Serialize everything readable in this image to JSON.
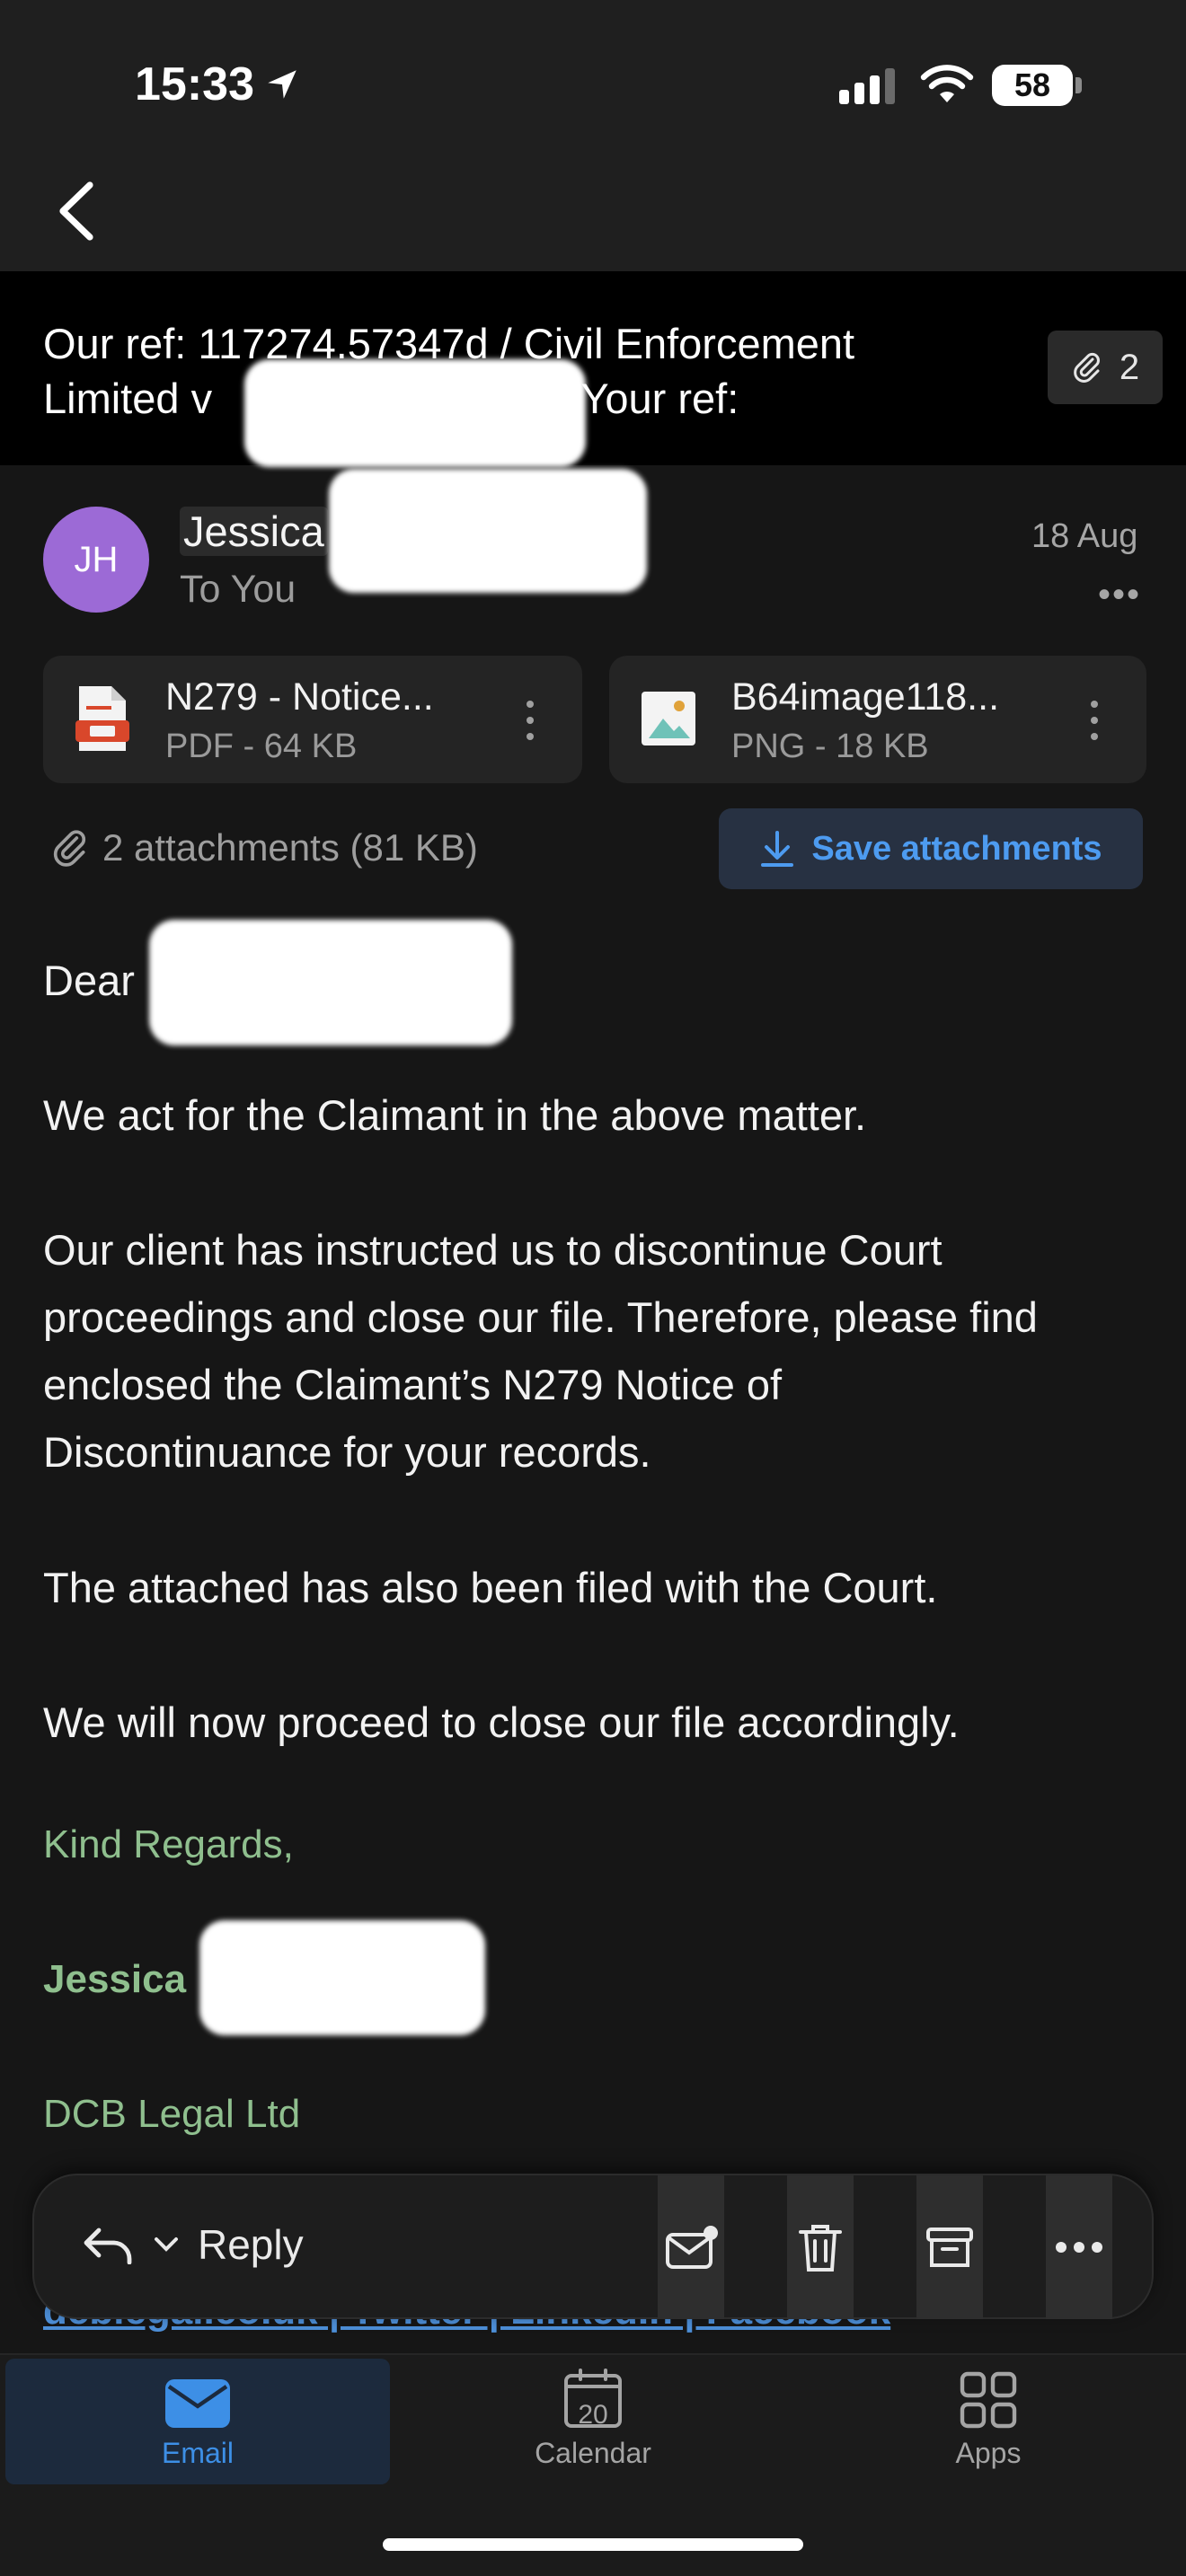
{
  "status_bar": {
    "time": "15:33",
    "battery": "58"
  },
  "subject": {
    "text": "Our ref: 117274.57347d / Civil Enforcement Limited v ████████████ / Your ref:",
    "line1": "Our ref: 117274.57347d / Civil Enforcement",
    "line2_a": "Limited v",
    "line2_b": "/ Your ref:",
    "attachment_count": "2"
  },
  "sender": {
    "initials": "JH",
    "name": "Jessica",
    "recipient": "To You",
    "date": "18 Aug",
    "more": "•••"
  },
  "attachments": [
    {
      "name": "N279 - Notice...",
      "meta": "PDF - 64 KB",
      "icon": "pdf-file-icon"
    },
    {
      "name": "B64image118...",
      "meta": "PNG - 18 KB",
      "icon": "image-file-icon"
    }
  ],
  "attachment_summary": "2 attachments (81 KB)",
  "save_button": "Save attachments",
  "body": {
    "greeting": "Dear",
    "p1": "We act for the Claimant in the above matter.",
    "p2_l1": "Our client has instructed us to discontinue Court",
    "p2_l2": "proceedings and close our file. Therefore, please find",
    "p2_l3": "enclosed the Claimant’s N279 Notice of",
    "p2_l4": "Discontinuance for your records.",
    "p3": "The attached has also been filed with the Court.",
    "p4": "We will now proceed to close our file accordingly.",
    "closing": "Kind Regards,",
    "signature_name": "Jessica",
    "company": "DCB Legal Ltd",
    "links": "dcblegal.co.uk | Twitter | LinkedIn | Facebook"
  },
  "reply_bar": {
    "label": "Reply"
  },
  "tabs": [
    {
      "label": "Email",
      "icon": "mail-icon",
      "active": true
    },
    {
      "label": "Calendar",
      "icon": "calendar-icon",
      "badge": "20"
    },
    {
      "label": "Apps",
      "icon": "apps-grid-icon"
    }
  ],
  "colors": {
    "accent": "#3d8fe6",
    "avatar": "#9c6ad6",
    "signature_green": "#8fbf8e",
    "background": "#161616"
  }
}
